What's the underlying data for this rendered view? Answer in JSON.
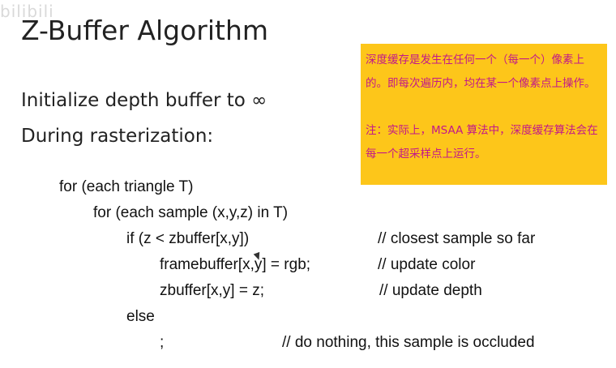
{
  "watermark": "bilibili",
  "slide": {
    "title": "Z-Buffer Algorithm",
    "bullet_1": "Initialize depth buffer to ∞",
    "bullet_2": "During rasterization:"
  },
  "note": {
    "paragraph_1": "深度缓存是发生在任何一个（每一个）像素上的。即每次遍历内，均在某一个像素点上操作。",
    "paragraph_2": "注：实际上，MSAA 算法中，深度缓存算法会在每一个超采样点上运行。"
  },
  "code": {
    "line_1": "for (each triangle T)",
    "line_2": "for (each sample (x,y,z) in T)",
    "line_3": "if (z < zbuffer[x,y])",
    "line_4": "framebuffer[x,y] = rgb;",
    "line_5": "zbuffer[x,y] = z;",
    "line_6": "else",
    "line_7": ";",
    "comment_3": "// closest sample so far",
    "comment_4": "// update color",
    "comment_5": "// update depth",
    "comment_7": "// do nothing, this sample is occluded"
  }
}
